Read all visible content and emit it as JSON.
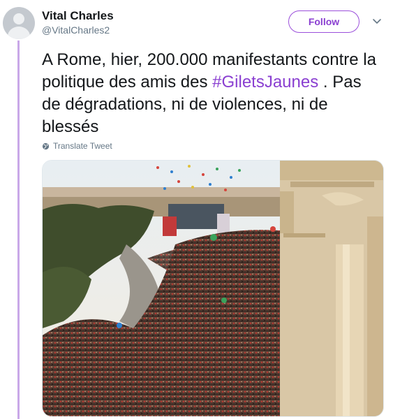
{
  "user": {
    "display_name": "Vital Charles",
    "handle": "@VitalCharles2"
  },
  "follow_label": "Follow",
  "tweet": {
    "text_before": "A Rome, hier, 200.000 manifestants contre la politique des amis des ",
    "hashtag": "#GiletsJaunes",
    "text_after": " . Pas de dégradations, ni de violences, ni de blessés"
  },
  "translate_label": "Translate Tweet",
  "icons": [
    "avatar-default",
    "chevron-down-icon",
    "globe-icon"
  ],
  "colors": {
    "accent": "#8a3fd1",
    "thread_line": "#c9a8e8",
    "text": "#14171a",
    "secondary": "#657786"
  }
}
